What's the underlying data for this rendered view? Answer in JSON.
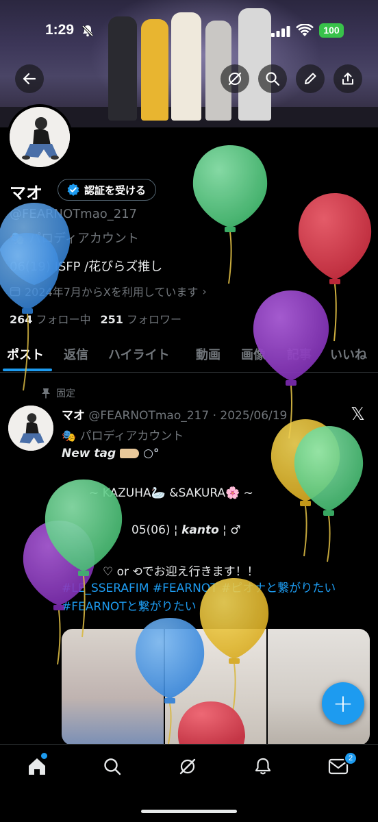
{
  "status": {
    "time": "1:29",
    "battery": "100"
  },
  "header_icons": [
    "back-arrow-icon",
    "grok-icon",
    "search-icon",
    "compose-icon",
    "share-icon"
  ],
  "profile": {
    "name": "マオ",
    "verify_button": "認証を受ける",
    "handle": "@FEARNOTmao_217",
    "parody_label": "パロディアカウント",
    "bio": "06(19) ISFP /花びらズ推し",
    "joined": "2024年7月からXを利用しています",
    "following_count": "264",
    "following_label": "フォロー中",
    "followers_count": "251",
    "followers_label": "フォロワー"
  },
  "tabs": [
    "ポスト",
    "返信",
    "ハイライト",
    "動画",
    "画像",
    "記事",
    "いいね"
  ],
  "post": {
    "pinned_label": "固定",
    "author": "マオ",
    "meta": "@FEARNOTmao_217 · 2025/06/19",
    "parody_label": "パロディアカウント",
    "new_tag": "New tag",
    "line_kazuha": "~ KAZUHA🦢 &SAKURA🌸 ~",
    "line_info_a": "05(06) ¦ ",
    "line_info_b": "kanto",
    "line_info_c": " ¦ ♂",
    "line_greet": "♡ or ⟲でお迎え行きます！！",
    "hashtags": "#LE_SSERAFIM #FEARNOT #ピオナと繋がりたい　#FEARNOTと繋がりたい"
  },
  "nav": {
    "messages_badge": "2"
  },
  "colors": {
    "accent": "#1d9bf0",
    "background": "#000000",
    "muted": "#71767b"
  }
}
